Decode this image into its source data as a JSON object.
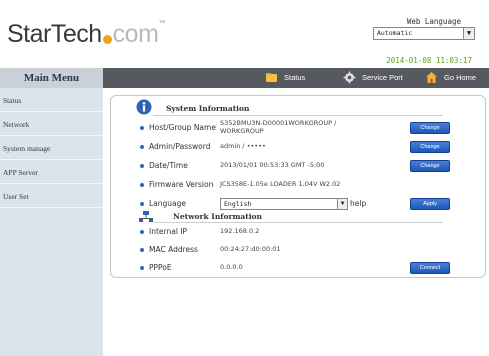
{
  "header": {
    "logo_text_dark": "StarTech",
    "logo_text_light": "com",
    "logo_tm": "™",
    "web_language_label": "Web Language",
    "web_language_value": "Automatic",
    "datetime": "2014-01-08 11:03:17"
  },
  "menu": {
    "title": "Main Menu",
    "items": [
      "Status",
      "Network",
      "System manage",
      "APP Server",
      "User Set"
    ]
  },
  "nav": {
    "items": [
      {
        "label": "Status",
        "icon": "folder-icon"
      },
      {
        "label": "Service Port",
        "icon": "gear-icon"
      },
      {
        "label": "Go Home",
        "icon": "home-icon"
      }
    ]
  },
  "system_info": {
    "title": "System Information",
    "rows": [
      {
        "label": "Host/Group Name",
        "value_line1": "S352BMU3N-D00001WORKGROUP /",
        "value_line2": "WORKGROUP",
        "button": "Change"
      },
      {
        "label": "Admin/Password",
        "value": "admin / •••••",
        "button": "Change"
      },
      {
        "label": "Date/Time",
        "value": "2013/01/01 00:53:33 GMT -5:00",
        "button": "Change"
      },
      {
        "label": "Firmware Version",
        "value": "JCS358E-1.05e LOADER 1.04V W2.02"
      },
      {
        "label": "Language",
        "select": "English",
        "help": "help",
        "button": "Apply"
      }
    ]
  },
  "network_info": {
    "title": "Network Information",
    "rows": [
      {
        "label": "Internal IP",
        "value": "192.168.0.2"
      },
      {
        "label": "MAC Address",
        "value": "00:24:27:d0:00:01"
      },
      {
        "label": "PPPoE",
        "value": "0.0.0.0",
        "button": "Connect"
      }
    ]
  },
  "colors": {
    "nav_bar": "#56595f",
    "sidebar": "#dbe3ec",
    "accent_green": "#5aa321",
    "button_blue": "#1d57b8",
    "logo_orange": "#f0a21b"
  }
}
